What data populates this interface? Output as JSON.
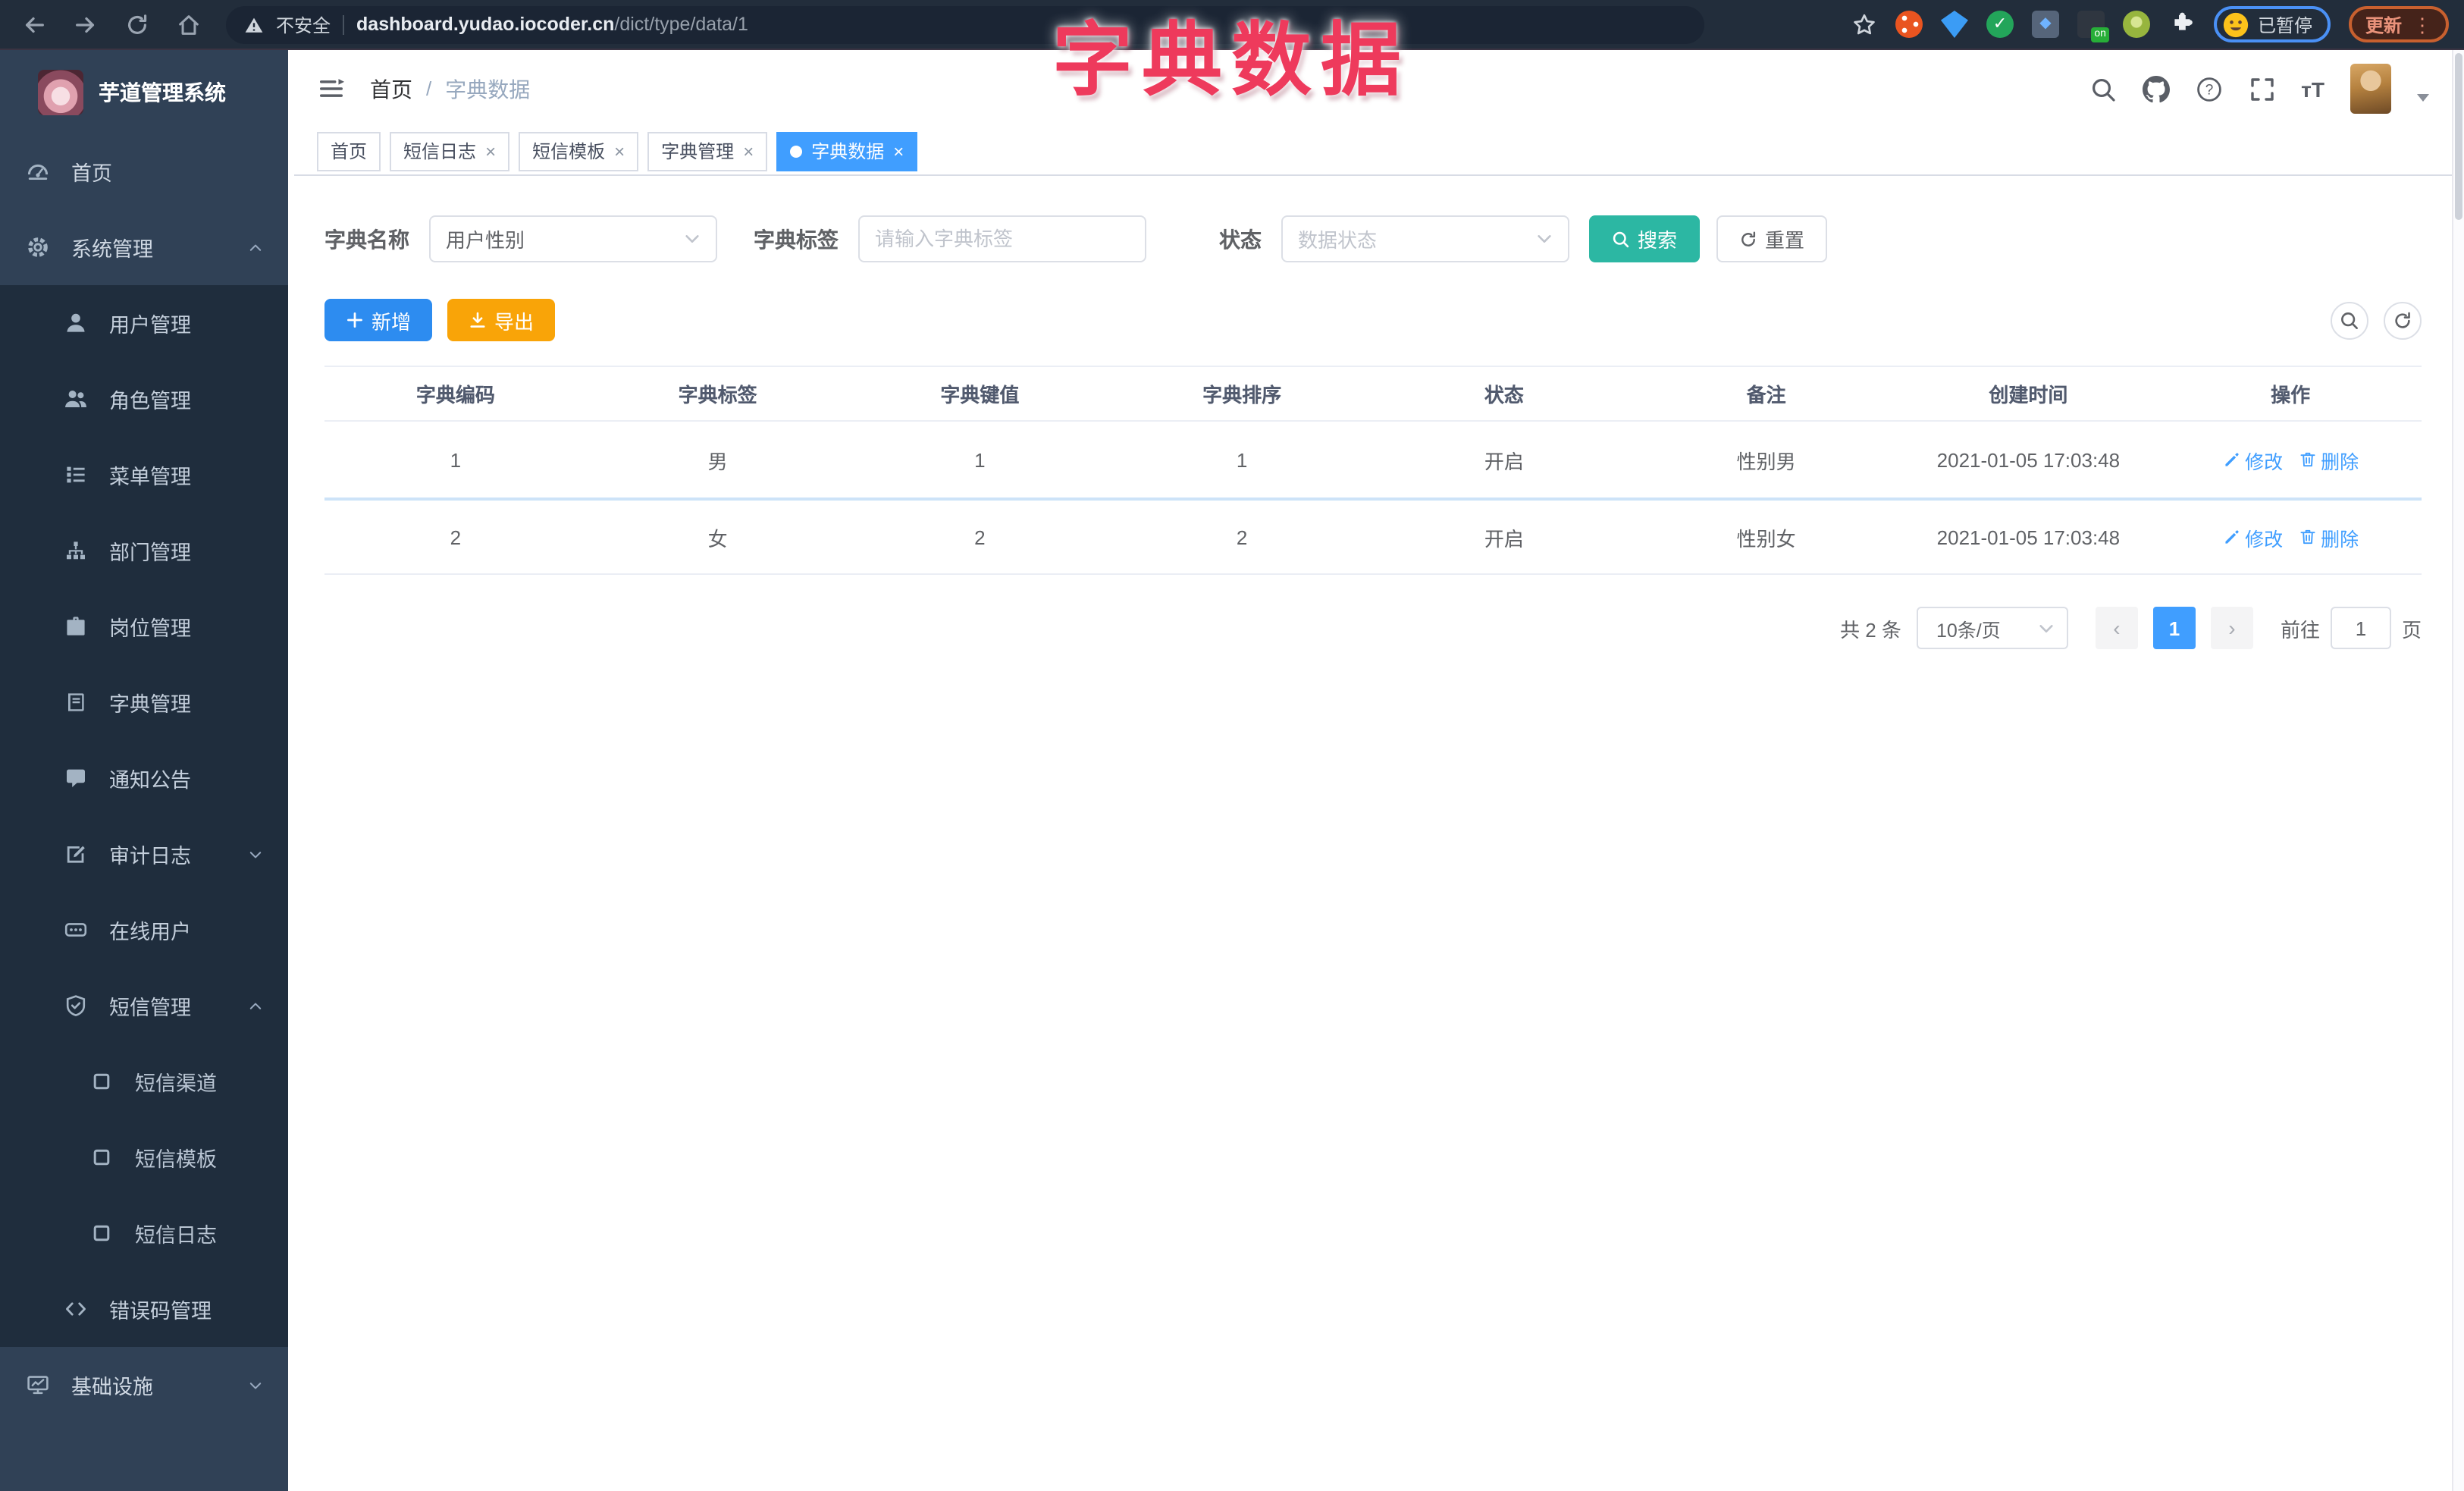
{
  "browser": {
    "security_warning": "不安全",
    "url_domain": "dashboard.yudao.iocoder.cn",
    "url_path": "/dict/type/data/1",
    "paused_label": "已暂停",
    "update_label": "更新"
  },
  "overlay": {
    "title": "字典数据",
    "color": "#ee3a5c"
  },
  "sidebar": {
    "logo_title": "芋道管理系统",
    "items": [
      {
        "label": "首页",
        "icon": "dashboard-icon",
        "level": 1
      },
      {
        "label": "系统管理",
        "icon": "gear-icon",
        "level": 1,
        "expanded": true
      },
      {
        "label": "用户管理",
        "icon": "user-icon",
        "level": 2
      },
      {
        "label": "角色管理",
        "icon": "users-icon",
        "level": 2
      },
      {
        "label": "菜单管理",
        "icon": "menu-list-icon",
        "level": 2
      },
      {
        "label": "部门管理",
        "icon": "org-tree-icon",
        "level": 2
      },
      {
        "label": "岗位管理",
        "icon": "briefcase-icon",
        "level": 2
      },
      {
        "label": "字典管理",
        "icon": "book-icon",
        "level": 2
      },
      {
        "label": "通知公告",
        "icon": "announcement-icon",
        "level": 2
      },
      {
        "label": "审计日志",
        "icon": "audit-icon",
        "level": 2,
        "expanded": false
      },
      {
        "label": "在线用户",
        "icon": "online-icon",
        "level": 2
      },
      {
        "label": "短信管理",
        "icon": "shield-icon",
        "level": 2,
        "expanded": true
      },
      {
        "label": "短信渠道",
        "icon": "square-icon",
        "level": 3
      },
      {
        "label": "短信模板",
        "icon": "square-icon",
        "level": 3
      },
      {
        "label": "短信日志",
        "icon": "square-icon",
        "level": 3
      },
      {
        "label": "错误码管理",
        "icon": "code-icon",
        "level": 2
      },
      {
        "label": "基础设施",
        "icon": "monitor-icon",
        "level": 1,
        "expanded": false
      }
    ]
  },
  "header": {
    "breadcrumb": {
      "home": "首页",
      "current": "字典数据"
    }
  },
  "tabs": [
    {
      "label": "首页",
      "closable": false,
      "active": false
    },
    {
      "label": "短信日志",
      "closable": true,
      "active": false
    },
    {
      "label": "短信模板",
      "closable": true,
      "active": false
    },
    {
      "label": "字典管理",
      "closable": true,
      "active": false
    },
    {
      "label": "字典数据",
      "closable": true,
      "active": true
    }
  ],
  "filters": {
    "name_label": "字典名称",
    "name_value": "用户性别",
    "tag_label": "字典标签",
    "tag_placeholder": "请输入字典标签",
    "status_label": "状态",
    "status_placeholder": "数据状态",
    "search_label": "搜索",
    "reset_label": "重置"
  },
  "toolbar": {
    "add_label": "新增",
    "export_label": "导出"
  },
  "table": {
    "columns": [
      "字典编码",
      "字典标签",
      "字典键值",
      "字典排序",
      "状态",
      "备注",
      "创建时间",
      "操作"
    ],
    "rows": [
      {
        "code": "1",
        "label": "男",
        "value": "1",
        "sort": "1",
        "status": "开启",
        "remark": "性别男",
        "created": "2021-01-05 17:03:48"
      },
      {
        "code": "2",
        "label": "女",
        "value": "2",
        "sort": "2",
        "status": "开启",
        "remark": "性别女",
        "created": "2021-01-05 17:03:48"
      }
    ],
    "edit_label": "修改",
    "delete_label": "删除"
  },
  "pagination": {
    "total": "共 2 条",
    "page_size": "10条/页",
    "current_page": "1",
    "goto_label": "前往",
    "goto_value": "1",
    "page_unit": "页"
  },
  "colors": {
    "accent_blue": "#409eff",
    "search_teal": "#2cb7a3",
    "export_orange": "#f9a408",
    "overlay_red": "#ee3a5c",
    "sidebar_bg": "#304156",
    "submenu_bg": "#1f2d3d"
  }
}
